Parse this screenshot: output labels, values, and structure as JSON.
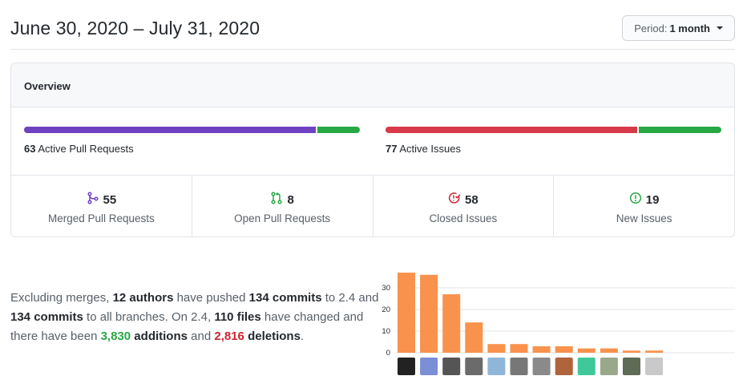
{
  "header": {
    "date_range": "June 30, 2020 – July 31, 2020",
    "period_prefix": "Period:",
    "period_value": "1 month"
  },
  "overview": {
    "title": "Overview",
    "pull_requests": {
      "count": "63",
      "label": "Active Pull Requests",
      "merged_fraction": 0.873,
      "open_fraction": 0.127,
      "colors": {
        "merged": "#6f42c1",
        "open": "#28a745"
      }
    },
    "issues": {
      "count": "77",
      "label": "Active Issues",
      "closed_fraction": 0.753,
      "new_fraction": 0.247,
      "colors": {
        "closed": "#d73a49",
        "new": "#28a745"
      }
    },
    "stats": [
      {
        "icon": "git-merge-icon",
        "color": "#6f42c1",
        "value": "55",
        "label": "Merged Pull Requests"
      },
      {
        "icon": "git-pull-request-icon",
        "color": "#28a745",
        "value": "8",
        "label": "Open Pull Requests"
      },
      {
        "icon": "issue-closed-icon",
        "color": "#cb2431",
        "value": "58",
        "label": "Closed Issues"
      },
      {
        "icon": "issue-opened-icon",
        "color": "#28a745",
        "value": "19",
        "label": "New Issues"
      }
    ]
  },
  "summary": {
    "t1": "Excluding merges, ",
    "authors": "12 authors",
    "t2": " have pushed ",
    "commits_branch": "134 commits",
    "t3": " to 2.4 and ",
    "commits_all": "134 commits",
    "t4": " to all branches. On 2.4, ",
    "files": "110 files",
    "t5": " have changed and there have been ",
    "additions": "3,830",
    "t6": " additions",
    "t7": " and ",
    "deletions": "2,816",
    "t8": " deletions",
    "t9": "."
  },
  "chart_data": {
    "type": "bar",
    "categories": [
      "author-1",
      "author-2",
      "author-3",
      "author-4",
      "author-5",
      "author-6",
      "author-7",
      "author-8",
      "author-9",
      "author-10",
      "author-11",
      "author-12"
    ],
    "values": [
      37,
      36,
      27,
      14,
      4,
      4,
      3,
      3,
      2,
      2,
      1,
      1
    ],
    "yticks": [
      "0",
      "10",
      "20",
      "30"
    ],
    "ylim": [
      0,
      40
    ],
    "bar_color": "#f9924c",
    "grid": true,
    "avatar_colors": [
      "#222222",
      "#7b8fd6",
      "#555555",
      "#6b6b6b",
      "#8fb6d8",
      "#777777",
      "#8a8a8a",
      "#b0643c",
      "#3fc99a",
      "#9aa88a",
      "#5e6b55",
      "#c9c9c9"
    ]
  }
}
